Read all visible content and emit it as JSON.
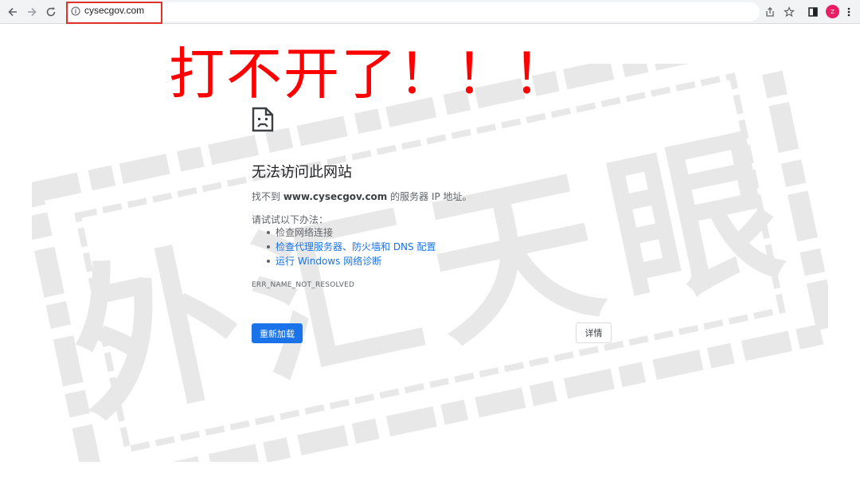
{
  "browser": {
    "url": "cysecgov.com",
    "avatar_initial": "Z"
  },
  "annotation": {
    "text": "打不开了！！！",
    "color": "#ff0000"
  },
  "error_page": {
    "title": "无法访问此网站",
    "desc_prefix": "找不到 ",
    "desc_domain": "www.cysecgov.com",
    "desc_suffix": " 的服务器 IP 地址。",
    "try_label": "请试试以下办法：",
    "suggestions": [
      "检查网络连接",
      "检查代理服务器、防火墙和 DNS 配置",
      "运行 Windows 网络诊断"
    ],
    "error_code": "ERR_NAME_NOT_RESOLVED",
    "reload_label": "重新加载",
    "details_label": "详情"
  },
  "watermark": {
    "text": "外汇天眼"
  },
  "colors": {
    "accent": "#1a73e8",
    "annotation_box": "#e0312b"
  }
}
